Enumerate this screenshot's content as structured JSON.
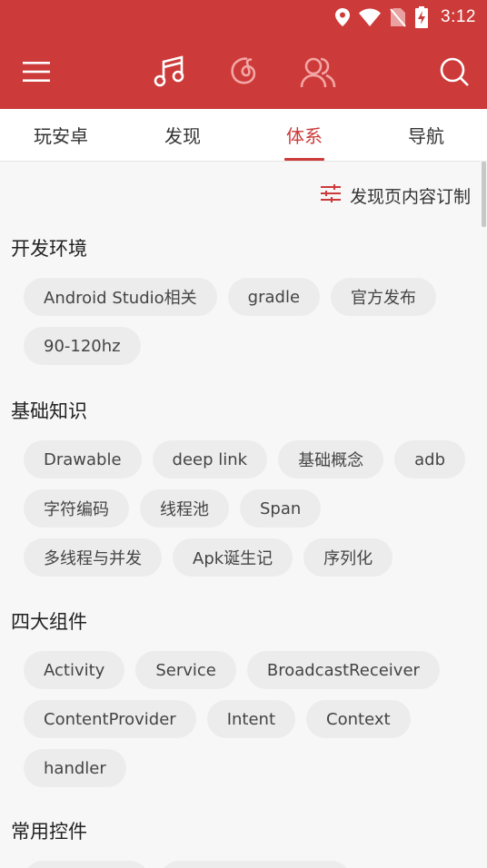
{
  "status_bar": {
    "time": "3:12"
  },
  "toolbar": {
    "menu_icon": "hamburger-menu-icon",
    "tab_icons": [
      "music-note-icon",
      "netease-cloud-icon",
      "friends-icon"
    ],
    "search_icon": "search-icon"
  },
  "tabs": [
    {
      "label": "玩安卓",
      "active": false
    },
    {
      "label": "发现",
      "active": false
    },
    {
      "label": "体系",
      "active": true
    },
    {
      "label": "导航",
      "active": false
    }
  ],
  "customize": {
    "label": "发现页内容订制",
    "icon": "sliders-icon"
  },
  "sections": [
    {
      "title": "开发环境",
      "chips": [
        "Android Studio相关",
        "gradle",
        "官方发布",
        "90-120hz"
      ]
    },
    {
      "title": "基础知识",
      "chips": [
        "Drawable",
        "deep link",
        "基础概念",
        "adb",
        "字符编码",
        "线程池",
        "Span",
        "多线程与并发",
        "Apk诞生记",
        "序列化"
      ]
    },
    {
      "title": "四大组件",
      "chips": [
        "Activity",
        "Service",
        "BroadcastReceiver",
        "ContentProvider",
        "Intent",
        "Context",
        "handler"
      ]
    },
    {
      "title": "常用控件",
      "chips": [
        "",
        ""
      ]
    }
  ],
  "colors": {
    "accent": "#cc3a39",
    "chip_bg": "#ececec",
    "page_bg": "#f7f7f7"
  }
}
